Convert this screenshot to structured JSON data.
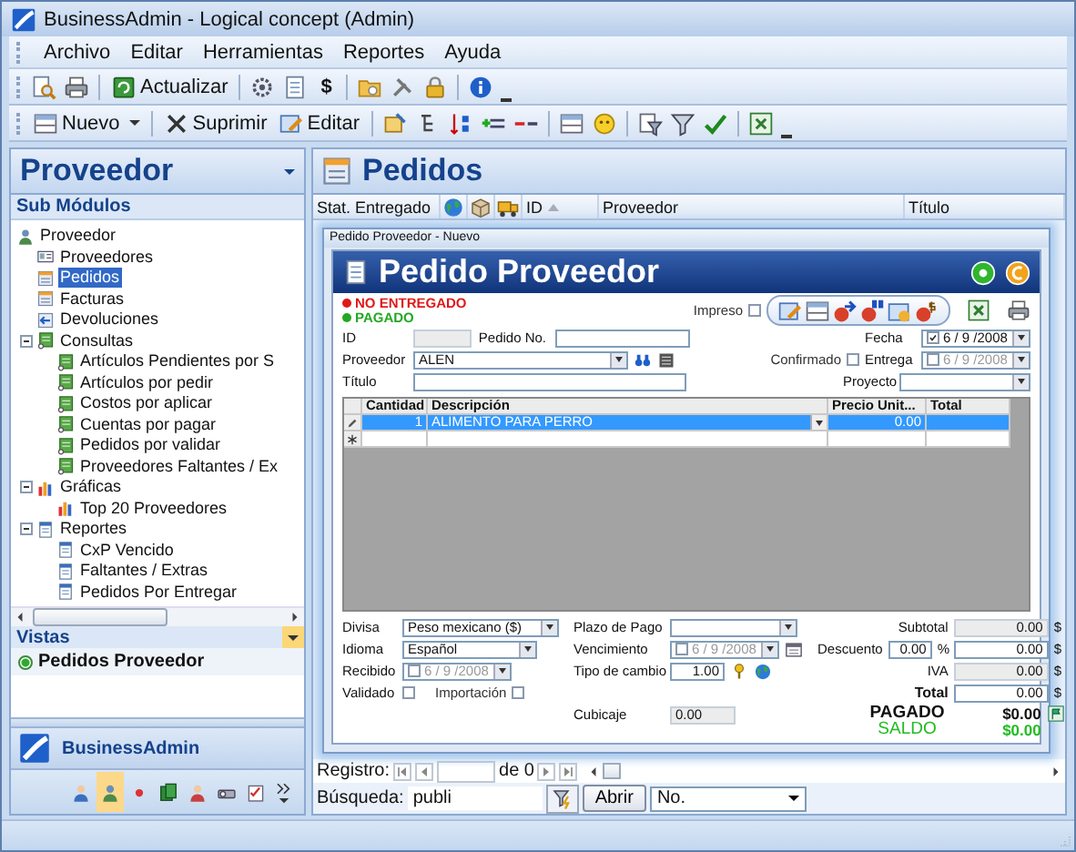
{
  "window": {
    "title": "BusinessAdmin - Logical concept (Admin)"
  },
  "menu": [
    "Archivo",
    "Editar",
    "Herramientas",
    "Reportes",
    "Ayuda"
  ],
  "toolbar_1": {
    "refresh": "Actualizar",
    "currency_glyph": "$"
  },
  "toolbar_2": {
    "new": "Nuevo",
    "delete": "Suprimir",
    "edit": "Editar"
  },
  "sidebar": {
    "title": "Proveedor",
    "section": "Sub Módulos",
    "tree": [
      {
        "label": "Proveedor",
        "selected": false,
        "children": [
          {
            "label": "Proveedores",
            "selected": false
          },
          {
            "label": "Pedidos",
            "selected": true
          },
          {
            "label": "Facturas",
            "selected": false
          },
          {
            "label": "Devoluciones",
            "selected": false
          },
          {
            "label": "Consultas",
            "selected": false,
            "expanded": true,
            "children": [
              {
                "label": "Artículos Pendientes por S",
                "selected": false
              },
              {
                "label": "Artículos por pedir",
                "selected": false
              },
              {
                "label": "Costos por aplicar",
                "selected": false
              },
              {
                "label": "Cuentas por pagar",
                "selected": false
              },
              {
                "label": "Pedidos por validar",
                "selected": false
              },
              {
                "label": "Proveedores Faltantes / Ex",
                "selected": false
              }
            ]
          },
          {
            "label": "Gráficas",
            "selected": false,
            "expanded": true,
            "children": [
              {
                "label": "Top 20 Proveedores",
                "selected": false
              }
            ]
          },
          {
            "label": "Reportes",
            "selected": false,
            "expanded": true,
            "children": [
              {
                "label": "CxP Vencido",
                "selected": false
              },
              {
                "label": "Faltantes / Extras",
                "selected": false
              },
              {
                "label": "Pedidos Por Entregar",
                "selected": false
              }
            ]
          }
        ]
      }
    ],
    "views_title": "Vistas",
    "views": [
      {
        "label": "Pedidos Proveedor",
        "selected": true
      }
    ],
    "brand": "BusinessAdmin",
    "nav_buttons": [
      {
        "selected": false
      },
      {
        "selected": true
      },
      {
        "selected": false
      },
      {
        "selected": false
      },
      {
        "selected": false
      },
      {
        "selected": false
      },
      {
        "selected": false
      }
    ]
  },
  "list": {
    "title": "Pedidos",
    "columns": [
      {
        "kind": "text",
        "label": "Stat. Entregado",
        "sorted": false
      },
      {
        "kind": "icon"
      },
      {
        "kind": "icon"
      },
      {
        "kind": "icon"
      },
      {
        "kind": "text",
        "label": "ID",
        "sorted": true
      },
      {
        "kind": "text",
        "label": "Proveedor",
        "sorted": false
      },
      {
        "kind": "text",
        "label": "Título",
        "sorted": false
      }
    ]
  },
  "dialog": {
    "title": "Pedido Proveedor - Nuevo",
    "heading": "Pedido Proveedor",
    "statuses": [
      {
        "label": "NO ENTREGADO",
        "color": "#e01818"
      },
      {
        "label": "PAGADO",
        "color": "#22a822"
      }
    ],
    "printed": {
      "label": "Impreso",
      "checked": false
    },
    "id_label": "ID",
    "order_no_label": "Pedido No.",
    "supplier": {
      "label": "Proveedor",
      "value": "ALEN"
    },
    "title_label": "Título",
    "date": {
      "label": "Fecha",
      "checked": true,
      "value": "6 / 9 /2008"
    },
    "confirmed": {
      "label": "Confirmado",
      "checked": false
    },
    "delivery": {
      "label": "Entrega",
      "checked": false,
      "value": "6 / 9 /2008"
    },
    "project_label": "Proyecto",
    "grid": {
      "columns": [
        "Cantidad",
        "Descripción",
        "Precio Unit...",
        "Total"
      ],
      "rows": [
        {
          "selected": true,
          "cells": [
            "1",
            "ALIMENTO PARA PERRO",
            "0.00"
          ]
        }
      ]
    },
    "currency": {
      "label": "Divisa",
      "value": "Peso mexicano ($)"
    },
    "language": {
      "label": "Idioma",
      "value": "Español"
    },
    "received": {
      "label": "Recibido",
      "checked": false,
      "value": "6 / 9 /2008"
    },
    "validated": {
      "label": "Validado",
      "checked": false
    },
    "import": {
      "label": "Importación",
      "checked": false
    },
    "payment_term_label": "Plazo de Pago",
    "due": {
      "label": "Vencimiento",
      "checked": false,
      "value": "6 / 9 /2008"
    },
    "exchange": {
      "label": "Tipo de cambio",
      "value": "1.00"
    },
    "volume": {
      "label": "Cubicaje",
      "value": "0.00"
    },
    "totals": [
      {
        "kind": "plain",
        "label": "Subtotal",
        "value": "0.00",
        "unit": "$"
      },
      {
        "kind": "discount",
        "label": "Descuento",
        "percent": "0.00",
        "percent_sign": "%",
        "value": "0.00",
        "unit": "$"
      },
      {
        "kind": "plain",
        "label": "IVA",
        "value": "0.00",
        "unit": "$"
      },
      {
        "kind": "total",
        "label": "Total",
        "value": "0.00",
        "unit": "$"
      }
    ],
    "paid": {
      "label": "PAGADO",
      "value": "$0.00"
    },
    "balance": {
      "label": "SALDO",
      "value": "$0.00"
    }
  },
  "navigator": {
    "label": "Registro:",
    "count": "de 0"
  },
  "search": {
    "label": "Búsqueda:",
    "value": "publi",
    "open": "Abrir",
    "field": "No."
  }
}
